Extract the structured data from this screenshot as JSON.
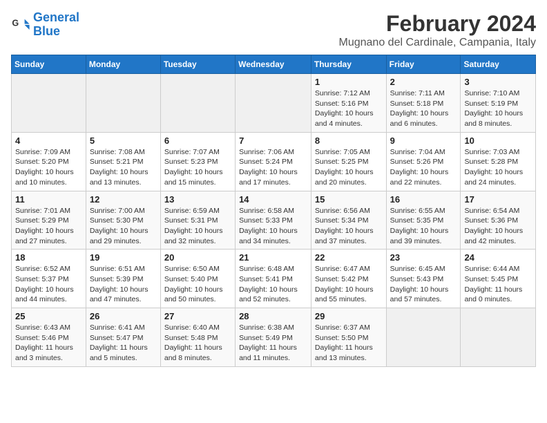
{
  "logo": {
    "line1": "General",
    "line2": "Blue"
  },
  "title": "February 2024",
  "location": "Mugnano del Cardinale, Campania, Italy",
  "days_header": [
    "Sunday",
    "Monday",
    "Tuesday",
    "Wednesday",
    "Thursday",
    "Friday",
    "Saturday"
  ],
  "weeks": [
    [
      {
        "day": "",
        "info": ""
      },
      {
        "day": "",
        "info": ""
      },
      {
        "day": "",
        "info": ""
      },
      {
        "day": "",
        "info": ""
      },
      {
        "day": "1",
        "info": "Sunrise: 7:12 AM\nSunset: 5:16 PM\nDaylight: 10 hours and 4 minutes."
      },
      {
        "day": "2",
        "info": "Sunrise: 7:11 AM\nSunset: 5:18 PM\nDaylight: 10 hours and 6 minutes."
      },
      {
        "day": "3",
        "info": "Sunrise: 7:10 AM\nSunset: 5:19 PM\nDaylight: 10 hours and 8 minutes."
      }
    ],
    [
      {
        "day": "4",
        "info": "Sunrise: 7:09 AM\nSunset: 5:20 PM\nDaylight: 10 hours and 10 minutes."
      },
      {
        "day": "5",
        "info": "Sunrise: 7:08 AM\nSunset: 5:21 PM\nDaylight: 10 hours and 13 minutes."
      },
      {
        "day": "6",
        "info": "Sunrise: 7:07 AM\nSunset: 5:23 PM\nDaylight: 10 hours and 15 minutes."
      },
      {
        "day": "7",
        "info": "Sunrise: 7:06 AM\nSunset: 5:24 PM\nDaylight: 10 hours and 17 minutes."
      },
      {
        "day": "8",
        "info": "Sunrise: 7:05 AM\nSunset: 5:25 PM\nDaylight: 10 hours and 20 minutes."
      },
      {
        "day": "9",
        "info": "Sunrise: 7:04 AM\nSunset: 5:26 PM\nDaylight: 10 hours and 22 minutes."
      },
      {
        "day": "10",
        "info": "Sunrise: 7:03 AM\nSunset: 5:28 PM\nDaylight: 10 hours and 24 minutes."
      }
    ],
    [
      {
        "day": "11",
        "info": "Sunrise: 7:01 AM\nSunset: 5:29 PM\nDaylight: 10 hours and 27 minutes."
      },
      {
        "day": "12",
        "info": "Sunrise: 7:00 AM\nSunset: 5:30 PM\nDaylight: 10 hours and 29 minutes."
      },
      {
        "day": "13",
        "info": "Sunrise: 6:59 AM\nSunset: 5:31 PM\nDaylight: 10 hours and 32 minutes."
      },
      {
        "day": "14",
        "info": "Sunrise: 6:58 AM\nSunset: 5:33 PM\nDaylight: 10 hours and 34 minutes."
      },
      {
        "day": "15",
        "info": "Sunrise: 6:56 AM\nSunset: 5:34 PM\nDaylight: 10 hours and 37 minutes."
      },
      {
        "day": "16",
        "info": "Sunrise: 6:55 AM\nSunset: 5:35 PM\nDaylight: 10 hours and 39 minutes."
      },
      {
        "day": "17",
        "info": "Sunrise: 6:54 AM\nSunset: 5:36 PM\nDaylight: 10 hours and 42 minutes."
      }
    ],
    [
      {
        "day": "18",
        "info": "Sunrise: 6:52 AM\nSunset: 5:37 PM\nDaylight: 10 hours and 44 minutes."
      },
      {
        "day": "19",
        "info": "Sunrise: 6:51 AM\nSunset: 5:39 PM\nDaylight: 10 hours and 47 minutes."
      },
      {
        "day": "20",
        "info": "Sunrise: 6:50 AM\nSunset: 5:40 PM\nDaylight: 10 hours and 50 minutes."
      },
      {
        "day": "21",
        "info": "Sunrise: 6:48 AM\nSunset: 5:41 PM\nDaylight: 10 hours and 52 minutes."
      },
      {
        "day": "22",
        "info": "Sunrise: 6:47 AM\nSunset: 5:42 PM\nDaylight: 10 hours and 55 minutes."
      },
      {
        "day": "23",
        "info": "Sunrise: 6:45 AM\nSunset: 5:43 PM\nDaylight: 10 hours and 57 minutes."
      },
      {
        "day": "24",
        "info": "Sunrise: 6:44 AM\nSunset: 5:45 PM\nDaylight: 11 hours and 0 minutes."
      }
    ],
    [
      {
        "day": "25",
        "info": "Sunrise: 6:43 AM\nSunset: 5:46 PM\nDaylight: 11 hours and 3 minutes."
      },
      {
        "day": "26",
        "info": "Sunrise: 6:41 AM\nSunset: 5:47 PM\nDaylight: 11 hours and 5 minutes."
      },
      {
        "day": "27",
        "info": "Sunrise: 6:40 AM\nSunset: 5:48 PM\nDaylight: 11 hours and 8 minutes."
      },
      {
        "day": "28",
        "info": "Sunrise: 6:38 AM\nSunset: 5:49 PM\nDaylight: 11 hours and 11 minutes."
      },
      {
        "day": "29",
        "info": "Sunrise: 6:37 AM\nSunset: 5:50 PM\nDaylight: 11 hours and 13 minutes."
      },
      {
        "day": "",
        "info": ""
      },
      {
        "day": "",
        "info": ""
      }
    ]
  ]
}
